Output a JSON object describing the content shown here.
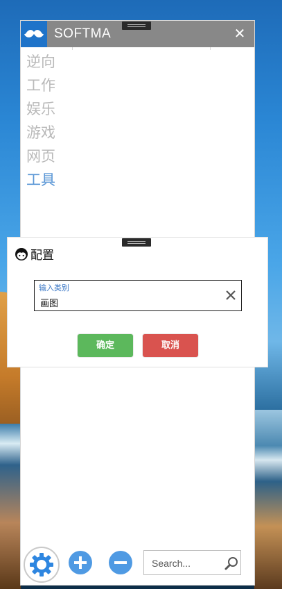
{
  "app": {
    "title": "SOFTMA",
    "close_glyph": "✕",
    "logo_icon": "mustache-icon",
    "accent_color": "#1e73c9",
    "titlebar_color": "#888888"
  },
  "categories": [
    {
      "label": "逆向",
      "active": false
    },
    {
      "label": "工作",
      "active": false
    },
    {
      "label": "娱乐",
      "active": false
    },
    {
      "label": "游戏",
      "active": false
    },
    {
      "label": "网页",
      "active": false
    },
    {
      "label": "工具",
      "active": true
    }
  ],
  "dialog": {
    "title": "配置",
    "icon": "face-icon",
    "field": {
      "label": "输入类别",
      "value": "画图"
    },
    "ok_label": "确定",
    "cancel_label": "取消",
    "ok_color": "#5cb85c",
    "cancel_color": "#d9534f"
  },
  "toolbar": {
    "settings_icon": "gear-icon",
    "add_icon": "plus-icon",
    "remove_icon": "minus-icon",
    "search_placeholder": "Search...",
    "search_icon": "search-icon"
  }
}
